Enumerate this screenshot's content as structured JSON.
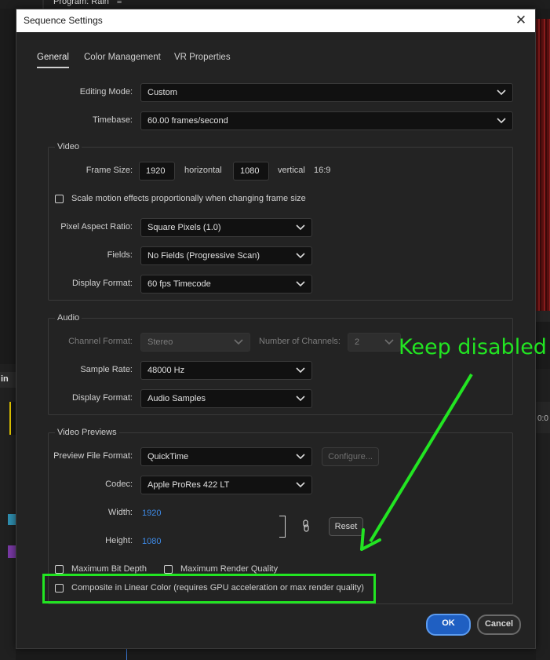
{
  "background": {
    "program_title": "Program: Rain",
    "timeline_tab_fragment": "in",
    "ruler_fragment": "0:0"
  },
  "dialog": {
    "title": "Sequence Settings",
    "close_glyph": "✕",
    "tabs": [
      {
        "label": "General",
        "active": true
      },
      {
        "label": "Color Management",
        "active": false
      },
      {
        "label": "VR Properties",
        "active": false
      }
    ],
    "editing_mode": {
      "label": "Editing Mode:",
      "value": "Custom"
    },
    "timebase": {
      "label": "Timebase:",
      "value": "60.00  frames/second"
    },
    "video": {
      "title": "Video",
      "frame_size_label": "Frame Size:",
      "width": "1920",
      "horizontal_label": "horizontal",
      "height": "1080",
      "vertical_label": "vertical",
      "aspect": "16:9",
      "scale_motion_label": "Scale motion effects proportionally when changing frame size",
      "scale_motion_checked": false,
      "pixel_aspect": {
        "label": "Pixel Aspect Ratio:",
        "value": "Square Pixels (1.0)"
      },
      "fields": {
        "label": "Fields:",
        "value": "No Fields (Progressive Scan)"
      },
      "display_format": {
        "label": "Display Format:",
        "value": "60 fps Timecode"
      }
    },
    "audio": {
      "title": "Audio",
      "channel_format": {
        "label": "Channel Format:",
        "value": "Stereo"
      },
      "num_channels": {
        "label": "Number of Channels:",
        "value": "2"
      },
      "sample_rate": {
        "label": "Sample Rate:",
        "value": "48000 Hz"
      },
      "display_format": {
        "label": "Display Format:",
        "value": "Audio Samples"
      }
    },
    "previews": {
      "title": "Video Previews",
      "file_format": {
        "label": "Preview File Format:",
        "value": "QuickTime"
      },
      "configure_label": "Configure...",
      "codec": {
        "label": "Codec:",
        "value": "Apple ProRes 422 LT"
      },
      "width_label": "Width:",
      "width_value": "1920",
      "height_label": "Height:",
      "height_value": "1080",
      "reset_label": "Reset",
      "max_bit_depth_label": "Maximum Bit Depth",
      "max_render_quality_label": "Maximum Render Quality",
      "composite_label": "Composite in Linear Color (requires GPU acceleration or max render quality)"
    },
    "ok_label": "OK",
    "cancel_label": "Cancel"
  },
  "annotation": {
    "text": "Keep disabled",
    "color": "#22e522"
  },
  "colors": {
    "dialog_bg": "#232323",
    "field_bg": "#111111",
    "accent_blue": "#3e8be8",
    "ok_blue": "#1f5fc2"
  }
}
